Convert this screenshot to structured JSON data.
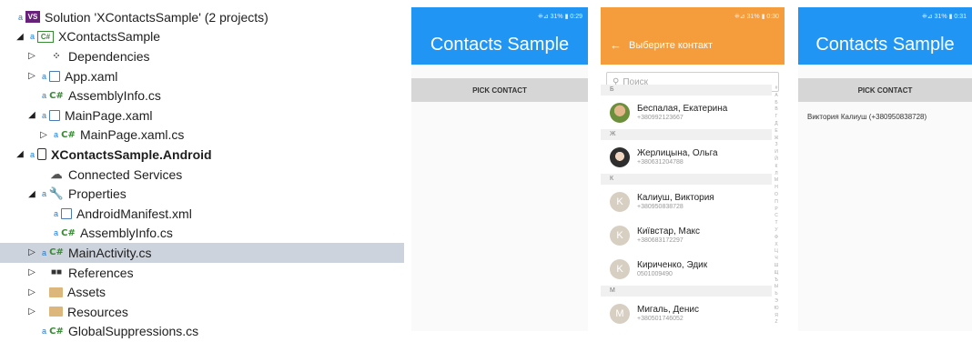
{
  "solution_explorer": {
    "rows": [
      {
        "label": "Solution 'XContactsSample' (2 projects)",
        "icon": "solution-icon",
        "arrow": "",
        "indent": 0,
        "bold": false
      },
      {
        "label": "XContactsSample",
        "icon": "csharp-project-icon",
        "arrow": "expanded",
        "indent": 1,
        "bold": false
      },
      {
        "label": "Dependencies",
        "icon": "dependencies-icon",
        "arrow": "collapsed",
        "indent": 2,
        "bold": false
      },
      {
        "label": "App.xaml",
        "icon": "xaml-file-icon",
        "arrow": "collapsed",
        "indent": 2,
        "bold": false
      },
      {
        "label": "AssemblyInfo.cs",
        "icon": "csharp-file-icon",
        "arrow": "",
        "indent": 2,
        "bold": false
      },
      {
        "label": "MainPage.xaml",
        "icon": "xaml-file-icon",
        "arrow": "expanded",
        "indent": 2,
        "bold": false
      },
      {
        "label": "MainPage.xaml.cs",
        "icon": "csharp-file-icon",
        "arrow": "collapsed",
        "indent": 3,
        "bold": false
      },
      {
        "label": "XContactsSample.Android",
        "icon": "android-project-icon",
        "arrow": "expanded",
        "indent": 1,
        "bold": true
      },
      {
        "label": "Connected Services",
        "icon": "connected-services-icon",
        "arrow": "",
        "indent": 2,
        "bold": false
      },
      {
        "label": "Properties",
        "icon": "wrench-icon",
        "arrow": "expanded",
        "indent": 2,
        "bold": false
      },
      {
        "label": "AndroidManifest.xml",
        "icon": "manifest-file-icon",
        "arrow": "",
        "indent": 3,
        "bold": false
      },
      {
        "label": "AssemblyInfo.cs",
        "icon": "csharp-file-icon",
        "arrow": "",
        "indent": 3,
        "bold": false
      },
      {
        "label": "MainActivity.cs",
        "icon": "csharp-file-icon",
        "arrow": "collapsed",
        "indent": 2,
        "bold": false,
        "selected": true
      },
      {
        "label": "References",
        "icon": "references-icon",
        "arrow": "collapsed",
        "indent": 2,
        "bold": false
      },
      {
        "label": "Assets",
        "icon": "folder-icon",
        "arrow": "collapsed",
        "indent": 2,
        "bold": false
      },
      {
        "label": "Resources",
        "icon": "folder-icon",
        "arrow": "collapsed",
        "indent": 2,
        "bold": false
      },
      {
        "label": "GlobalSuppressions.cs",
        "icon": "csharp-file-icon",
        "arrow": "",
        "indent": 2,
        "bold": false
      }
    ]
  },
  "phone1": {
    "status": "⁜⊿ 31% ▮ 0:29",
    "title": "Contacts Sample",
    "button": "PICK CONTACT"
  },
  "phone2": {
    "status": "⁜⊿ 31% ▮ 0:30",
    "title": "Выберите контакт",
    "search_placeholder": "Поиск",
    "sections": [
      {
        "header": "Б",
        "contacts": [
          {
            "name": "Беспалая, Екатерина",
            "phone": "+380992123667",
            "avatar": "photo1"
          }
        ]
      },
      {
        "header": "Ж",
        "contacts": [
          {
            "name": "Жерлицына, Ольга",
            "phone": "+380631204788",
            "avatar": "photo2"
          }
        ]
      },
      {
        "header": "К",
        "contacts": [
          {
            "name": "Калиуш, Виктория",
            "phone": "+380950838728",
            "avatar": "letter",
            "letter": "K"
          },
          {
            "name": "Київстар, Макс",
            "phone": "+380683172297",
            "avatar": "letter",
            "letter": "K"
          },
          {
            "name": "Кириченко, Эдик",
            "phone": "0501009490",
            "avatar": "letter",
            "letter": "K"
          }
        ]
      },
      {
        "header": "М",
        "contacts": [
          {
            "name": "Мигаль, Денис",
            "phone": "+380501746052",
            "avatar": "letter",
            "letter": "M"
          }
        ]
      }
    ],
    "alphabet": [
      "#",
      "А",
      "Б",
      "В",
      "Г",
      "Д",
      "Е",
      "Ж",
      "З",
      "И",
      "Й",
      "К",
      "Л",
      "М",
      "Н",
      "О",
      "П",
      "Р",
      "С",
      "Т",
      "У",
      "Ф",
      "Х",
      "Ц",
      "Ч",
      "Ш",
      "Щ",
      "Ъ",
      "Ы",
      "Ь",
      "Э",
      "Ю",
      "Я",
      "Z"
    ]
  },
  "phone3": {
    "status": "⁜⊿ 31% ▮ 0:31",
    "title": "Contacts Sample",
    "button": "PICK CONTACT",
    "result": "Виктория Калиуш (+380950838728)"
  },
  "colors": {
    "app_bar_blue": "#2195f3",
    "picker_orange": "#f59d3c",
    "selected_row": "#cdd3dd"
  }
}
